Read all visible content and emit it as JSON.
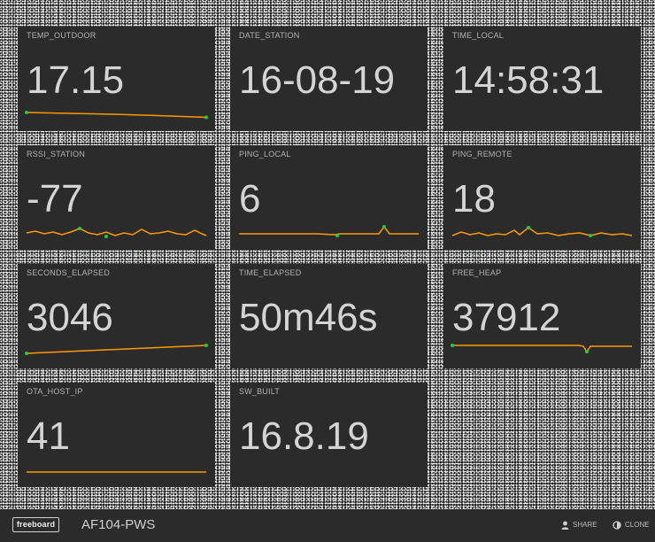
{
  "panes": [
    {
      "title": "TEMP_OUTDOOR",
      "value": "17.15"
    },
    {
      "title": "DATE_STATION",
      "value": "16-08-19"
    },
    {
      "title": "TIME_LOCAL",
      "value": "14:58:31"
    },
    {
      "title": "RSSI_STATION",
      "value": "-77"
    },
    {
      "title": "PING_LOCAL",
      "value": "6"
    },
    {
      "title": "PING_REMOTE",
      "value": "18"
    },
    {
      "title": "SECONDS_ELAPSED",
      "value": "3046"
    },
    {
      "title": "TIME_ELAPSED",
      "value": "50m46s"
    },
    {
      "title": "FREE_HEAP",
      "value": "37912"
    },
    {
      "title": "OTA_HOST_IP",
      "value": "41"
    },
    {
      "title": "SW_BUILT",
      "value": "16.8.19"
    }
  ],
  "footer": {
    "logo": "freeboard",
    "title": "AF104-PWS",
    "share_label": "SHARE",
    "clone_label": "CLONE"
  },
  "colors": {
    "sparkline": "#ff9900",
    "highlight": "#22cc44",
    "pane_background": "#2b2b2b"
  }
}
